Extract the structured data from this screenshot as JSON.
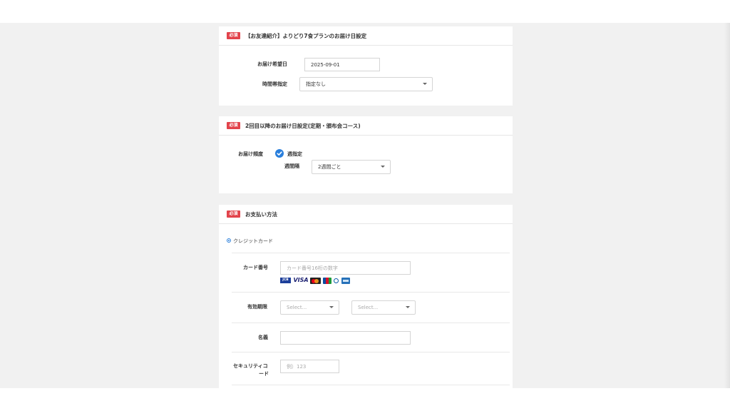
{
  "required_badge": "必須",
  "section1": {
    "title": "【お友達紹介】よりどり7食プランのお届け日設定",
    "delivery_date_label": "お届け希望日",
    "delivery_date_value": "2025-09-01",
    "time_slot_label": "時間帯指定",
    "time_slot_value": "指定なし"
  },
  "section2": {
    "title": "2回目以降のお届け日設定(定期・頒布会コース)",
    "frequency_label": "お届け頻度",
    "frequency_option": "週指定",
    "interval_label": "週間隔",
    "interval_value": "2週間ごと"
  },
  "section3": {
    "title": "お支払い方法",
    "payment_option": "クレジットカード",
    "card_number_label": "カード番号",
    "card_number_placeholder": "カード番号16桁の数字",
    "card_brands": [
      "JCB",
      "VISA",
      "MC",
      "JCB",
      "DC",
      "AMEX"
    ],
    "expiry_label": "有効期限",
    "expiry_month_value": "Select...",
    "expiry_year_value": "Select...",
    "name_label": "名義",
    "security_label_1": "セキュリティコ",
    "security_label_2": "ード",
    "security_placeholder": "例）123"
  },
  "colors": {
    "accent_blue": "#2a7fdc",
    "required_red": "#e2434b",
    "background_gray": "#f1f1f1"
  }
}
